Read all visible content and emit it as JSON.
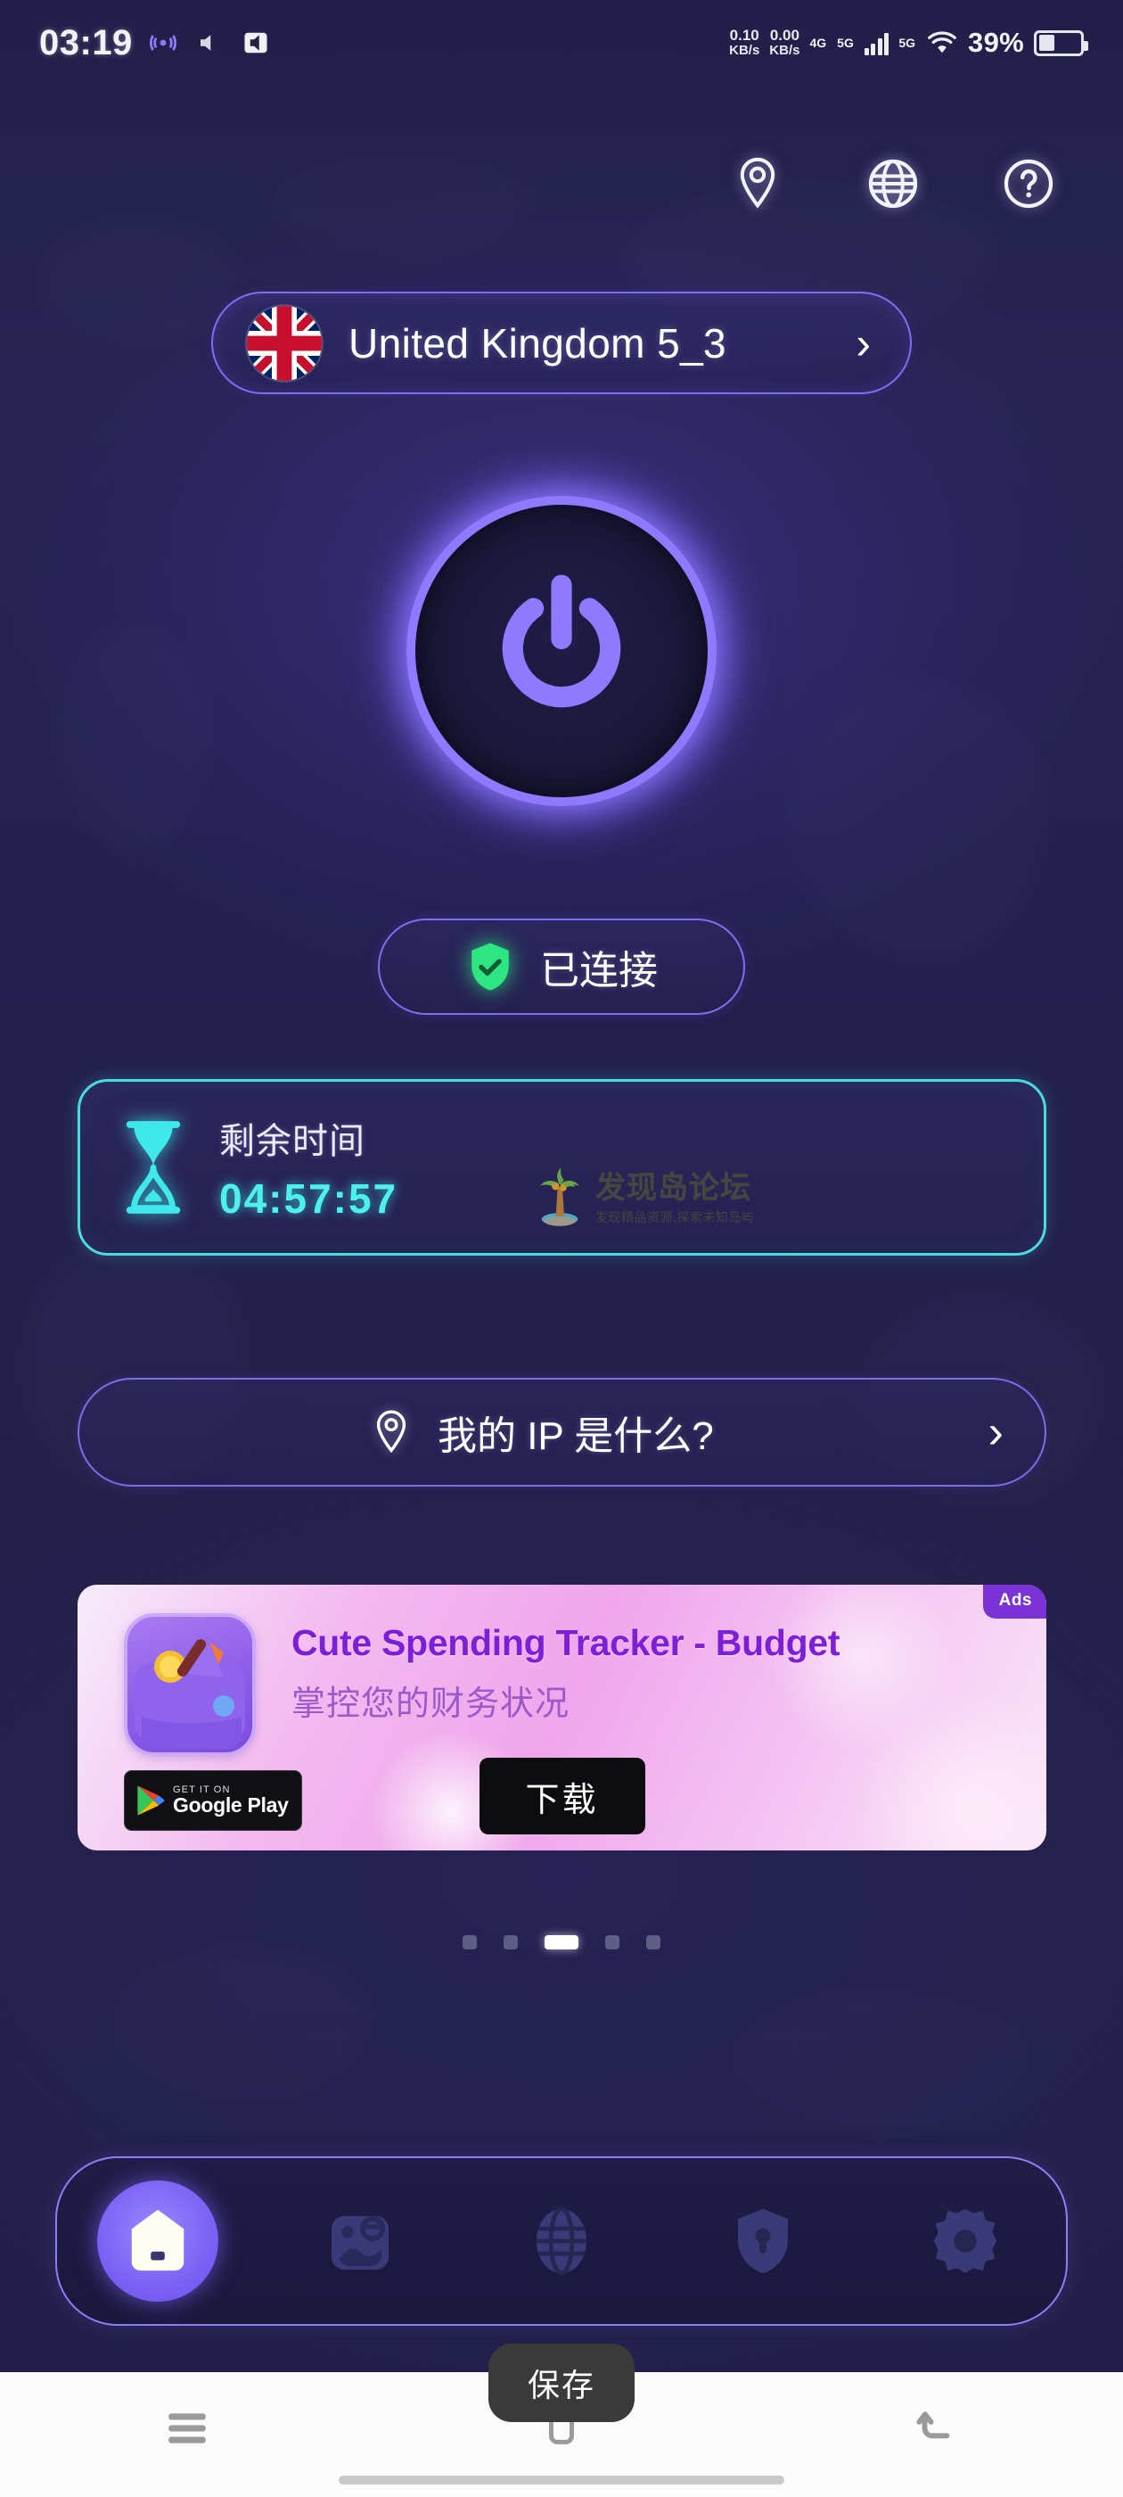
{
  "status_bar": {
    "clock": "03:19",
    "net_speed_value": "0.10",
    "net_speed_unit": "KB/s",
    "net_speed_value_2": "0.00",
    "net_speed_unit_2": "KB/s",
    "network_label_1": "4G",
    "network_label_2": "5G",
    "network_label_3": "5G",
    "battery_percent": "39%",
    "icons": [
      "signal-wave-icon",
      "mute-icon",
      "sound-icon",
      "wifi-icon",
      "battery-icon"
    ]
  },
  "header": {
    "icons": [
      {
        "name": "location-pin-icon",
        "label": "Location"
      },
      {
        "name": "globe-icon",
        "label": "Language"
      },
      {
        "name": "help-circle-icon",
        "label": "Help"
      }
    ]
  },
  "server": {
    "country": "United Kingdom 5_3",
    "flag": "uk-flag-icon",
    "chevron": "›"
  },
  "power": {
    "label": "power-button",
    "state": "on",
    "glow_color": "#8f79ff"
  },
  "connection": {
    "status_text": "已连接",
    "shield_color": "#2de682"
  },
  "timer": {
    "label": "剩余时间",
    "value": "04:57:57",
    "accent_color": "#4adbe0"
  },
  "watermark": {
    "main": "发现岛论坛",
    "sub": "发现精品资源,探索未知岛屿"
  },
  "my_ip": {
    "text": "我的 IP 是什么?",
    "chevron": "›"
  },
  "ad": {
    "badge": "Ads",
    "title": "Cute Spending Tracker - Budget",
    "subtitle": "掌控您的财务状况",
    "cta": "下载",
    "store_top": "GET IT ON",
    "store_bottom": "Google Play"
  },
  "carousel": {
    "total": 5,
    "active_index": 2
  },
  "bottom_nav": {
    "items": [
      {
        "name": "home-icon",
        "label": "Home",
        "active": true
      },
      {
        "name": "reward-gift-icon",
        "label": "Reward",
        "active": false
      },
      {
        "name": "globe-servers-icon",
        "label": "Servers",
        "active": false
      },
      {
        "name": "shield-lock-icon",
        "label": "Security",
        "active": false
      },
      {
        "name": "settings-gear-icon",
        "label": "Settings",
        "active": false
      }
    ],
    "active_color": "#7c63f5"
  },
  "android_nav": {
    "tooltip": "保存",
    "buttons": [
      {
        "name": "recents-menu-icon"
      },
      {
        "name": "home-square-icon"
      },
      {
        "name": "back-icon"
      }
    ]
  }
}
